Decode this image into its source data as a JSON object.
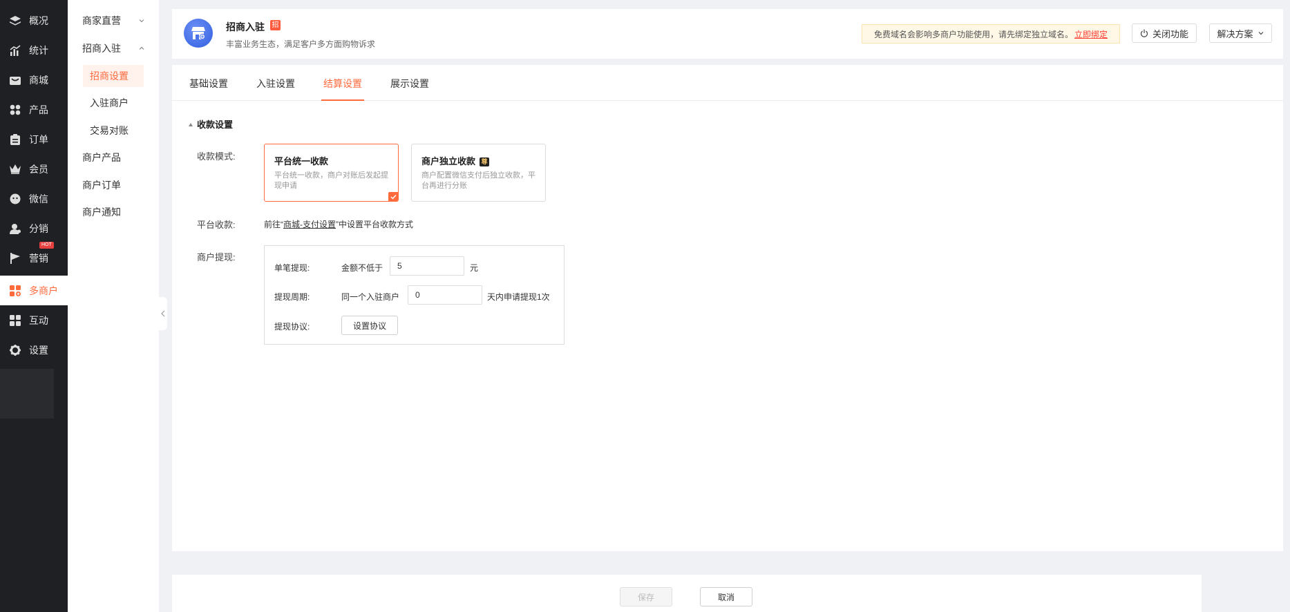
{
  "nav": {
    "items": [
      {
        "label": "概况",
        "icon": "layers-icon"
      },
      {
        "label": "统计",
        "icon": "chart-icon"
      },
      {
        "label": "商城",
        "icon": "shop-icon"
      },
      {
        "label": "产品",
        "icon": "grid-icon"
      },
      {
        "label": "订单",
        "icon": "clipboard-icon"
      },
      {
        "label": "会员",
        "icon": "crown-icon"
      },
      {
        "label": "微信",
        "icon": "wechat-icon"
      },
      {
        "label": "分销",
        "icon": "user-share-icon"
      },
      {
        "label": "营销",
        "icon": "flag-icon",
        "badge": "HOT"
      },
      {
        "label": "多商户",
        "icon": "multi-shop-icon"
      },
      {
        "label": "互动",
        "icon": "apps-icon"
      },
      {
        "label": "设置",
        "icon": "gear-icon"
      }
    ],
    "active_index": 9
  },
  "subnav": {
    "groups": [
      {
        "label": "商家直营"
      },
      {
        "label": "招商入驻",
        "children": [
          "招商设置",
          "入驻商户",
          "交易对账"
        ]
      },
      {
        "label": "商户产品"
      },
      {
        "label": "商户订单"
      },
      {
        "label": "商户通知"
      }
    ]
  },
  "header": {
    "title": "招商入驻",
    "badge": "招",
    "subtitle": "丰富业务生态，满足客户多方面购物诉求",
    "notice": "免费域名会影响多商户功能使用，请先绑定独立域名。",
    "notice_link": "立即绑定",
    "close_btn": "关闭功能",
    "solution_btn": "解决方案"
  },
  "tabs": [
    "基础设置",
    "入驻设置",
    "结算设置",
    "展示设置"
  ],
  "active_tab": 2,
  "section": {
    "title": "收款设置",
    "mode_label": "收款模式:",
    "modes": [
      {
        "title": "平台统一收款",
        "desc": "平台统一收款，商户对账后发起提现申请",
        "selected": true
      },
      {
        "title": "商户独立收款",
        "desc": "商户配置微信支付后独立收款，平台再进行分账",
        "vip": "尊",
        "selected": false
      }
    ],
    "platform_label": "平台收款:",
    "platform_pre": "前往“",
    "platform_link": "商城-支付设置",
    "platform_post": "”中设置平台收款方式",
    "withdraw_label": "商户提现:",
    "withdraw": {
      "single_label": "单笔提现:",
      "single_pre": "金额不低于",
      "single_value": "5",
      "single_unit": "元",
      "period_label": "提现周期:",
      "period_pre": "同一个入驻商户",
      "period_value": "0",
      "period_post": "天内申请提现1次",
      "agreement_label": "提现协议:",
      "agreement_btn": "设置协议"
    }
  },
  "footer": {
    "save": "保存",
    "cancel": "取消"
  },
  "colors": {
    "accent": "#ff6a3d",
    "nav_bg": "#1e2024",
    "link_red": "#ff3b30"
  }
}
